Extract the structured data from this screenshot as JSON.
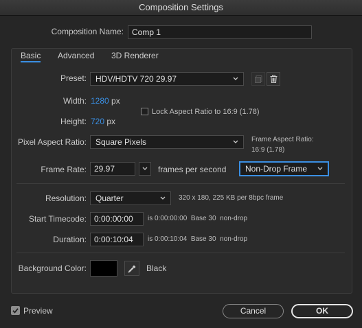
{
  "window": {
    "title": "Composition Settings"
  },
  "comp": {
    "name_label": "Composition Name:",
    "name_value": "Comp 1"
  },
  "tabs": [
    {
      "label": "Basic",
      "active": true
    },
    {
      "label": "Advanced",
      "active": false
    },
    {
      "label": "3D Renderer",
      "active": false
    }
  ],
  "preset": {
    "label": "Preset:",
    "value": "HDV/HDTV 720 29.97"
  },
  "width": {
    "label": "Width:",
    "value": "1280",
    "unit": "px"
  },
  "height": {
    "label": "Height:",
    "value": "720",
    "unit": "px"
  },
  "lock_aspect": {
    "label": "Lock Aspect Ratio to 16:9 (1.78)",
    "checked": false
  },
  "pixel_aspect": {
    "label": "Pixel Aspect Ratio:",
    "value": "Square Pixels"
  },
  "frame_aspect": {
    "label": "Frame Aspect Ratio:",
    "value": "16:9 (1.78)"
  },
  "frame_rate": {
    "label": "Frame Rate:",
    "value": "29.97",
    "unit": "frames per second",
    "drop_frame": "Non-Drop Frame"
  },
  "resolution": {
    "label": "Resolution:",
    "value": "Quarter",
    "info": "320 x 180, 225 KB per 8bpc frame"
  },
  "start_timecode": {
    "label": "Start Timecode:",
    "value": "0:00:00:00",
    "info": "is 0:00:00:00  Base 30  non-drop"
  },
  "duration": {
    "label": "Duration:",
    "value": "0:00:10:04",
    "info": "is 0:00:10:04  Base 30  non-drop"
  },
  "background": {
    "label": "Background Color:",
    "color": "#000000",
    "name": "Black"
  },
  "footer": {
    "preview_label": "Preview",
    "preview_checked": true,
    "cancel_label": "Cancel",
    "ok_label": "OK"
  },
  "colors": {
    "accent": "#3a8fe3"
  }
}
